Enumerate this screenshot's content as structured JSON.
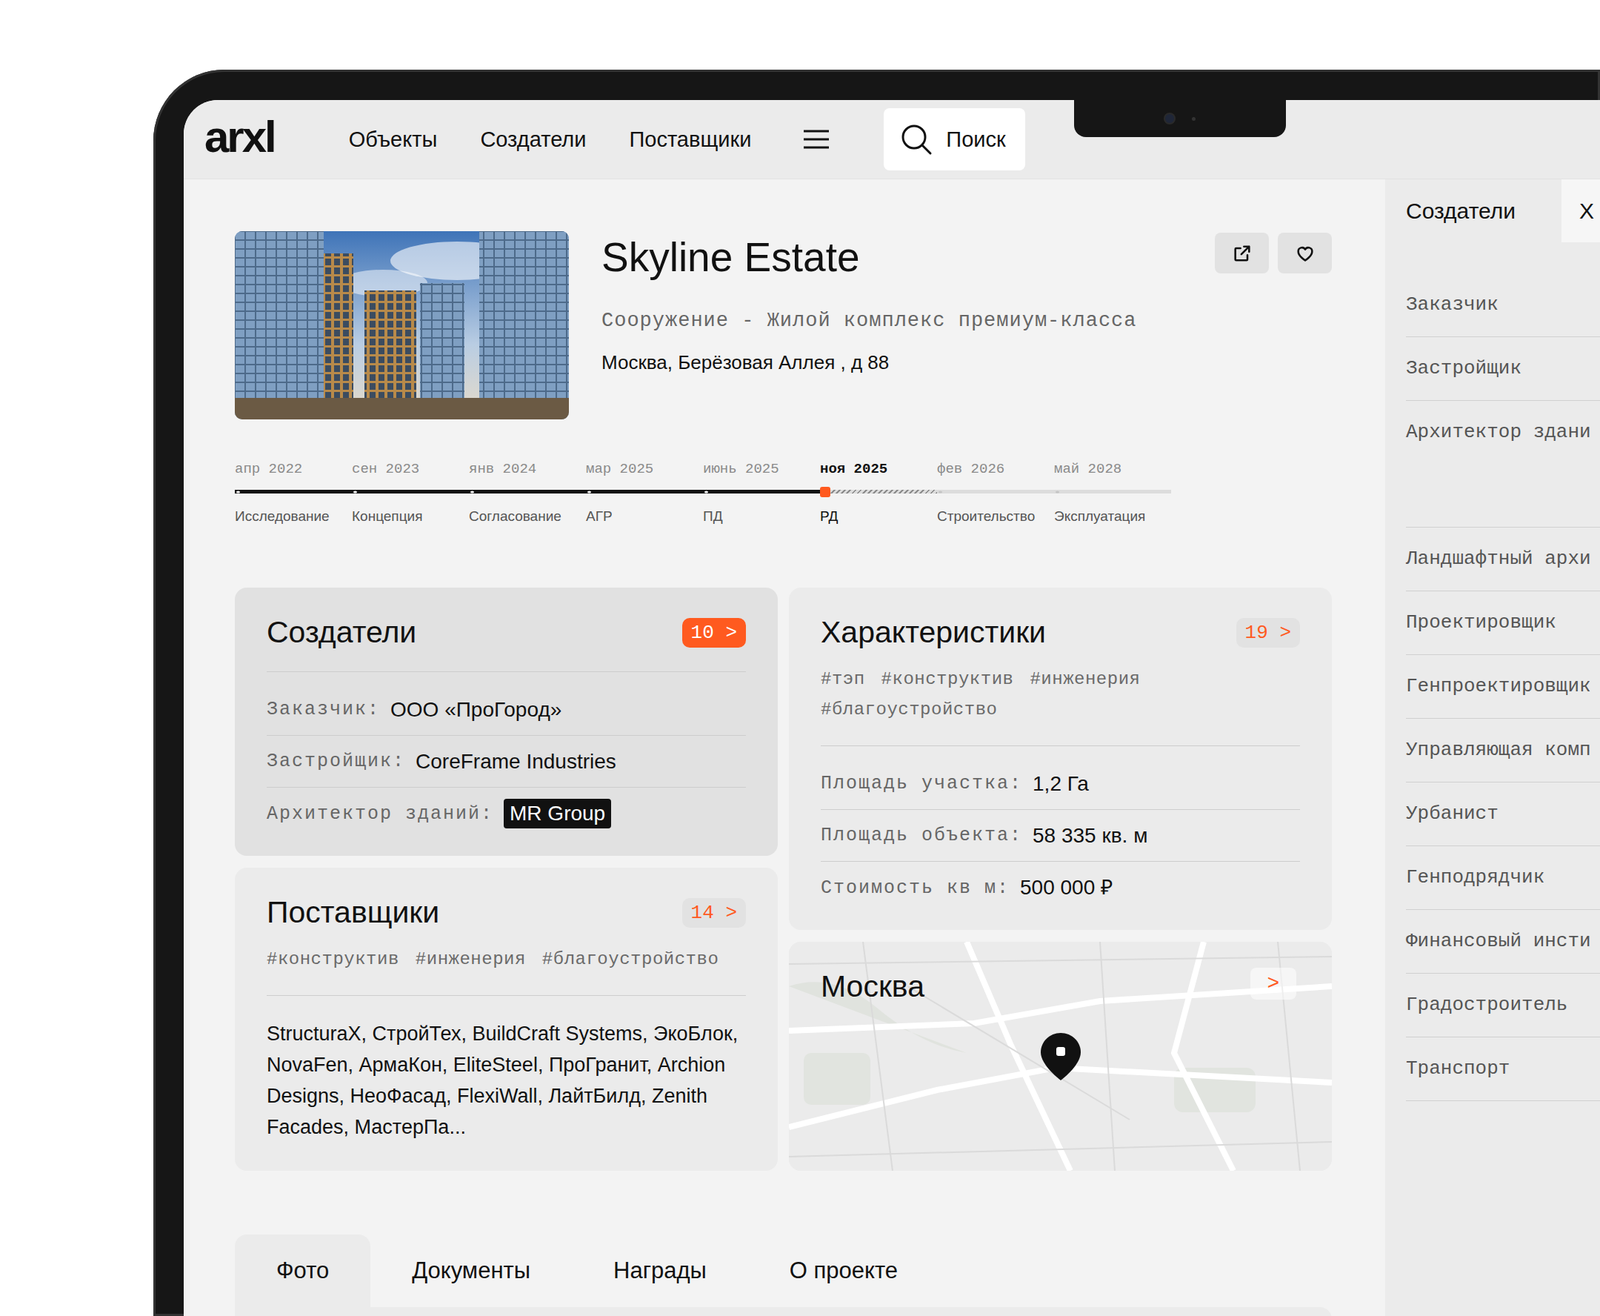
{
  "nav": {
    "logo": "arxl",
    "items": [
      {
        "label": "Объекты",
        "selected": false
      },
      {
        "label": "Создатели",
        "selected": false
      },
      {
        "label": "Поставщики",
        "selected": false
      }
    ],
    "search": {
      "placeholder": "Поиск"
    }
  },
  "project": {
    "title": "Skyline Estate",
    "type": "Сооружение - Жилой комплекс премиум-класса",
    "address": "Москва, Берёзовая Аллея , д 88",
    "favorite": false
  },
  "timeline": {
    "stages": [
      {
        "date": "апр 2022",
        "label": "Исследование",
        "status": "done"
      },
      {
        "date": "сен 2023",
        "label": "Концепция",
        "status": "done"
      },
      {
        "date": "янв 2024",
        "label": "Согласование",
        "status": "done"
      },
      {
        "date": "мар 2025",
        "label": "АГР",
        "status": "done"
      },
      {
        "date": "июнь 2025",
        "label": "ПД",
        "status": "done"
      },
      {
        "date": "ноя 2025",
        "label": "РД",
        "status": "current"
      },
      {
        "date": "фев 2026",
        "label": "Строительство",
        "status": "planned"
      },
      {
        "date": "май 2028",
        "label": "Эксплуатация",
        "status": "planned"
      }
    ]
  },
  "creators": {
    "title": "Создатели",
    "badge": "10 >",
    "highlighted": true,
    "rows": [
      {
        "label": "Заказчик:",
        "value": "ООО «ПроГород»",
        "highlighted": false
      },
      {
        "label": "Застройщик:",
        "value": "CoreFrame Industries",
        "highlighted": false
      },
      {
        "label": "Архитектор зданий:",
        "value": "MR Group",
        "highlighted": true
      }
    ]
  },
  "characteristics": {
    "title": "Характеристики",
    "badge": "19 >",
    "highlighted": false,
    "tags": [
      "#тэп",
      "#конструктив",
      "#инженерия",
      "#благоустройство"
    ],
    "rows": [
      {
        "label": "Площадь участка:",
        "value": "1,2 Га",
        "highlighted": false
      },
      {
        "label": "Площадь объекта:",
        "value": "58 335 кв. м",
        "highlighted": false
      },
      {
        "label": "Стоимость кв м:",
        "value": "500 000 ₽",
        "highlighted": false
      }
    ]
  },
  "suppliers": {
    "title": "Поставщики",
    "badge": "14 >",
    "highlighted": false,
    "tags": [
      "#конструктив",
      "#инженерия",
      "#благоустройство"
    ],
    "list": "StructuraX, СтройТех, BuildCraft Systems, ЭкоБлок, NovaFen, АрмаКон, EliteSteel, ПроГранит, Archion Designs, НеоФасад, FlexiWall, ЛайтБилд, Zenith Facades, МастерПа..."
  },
  "map": {
    "title": "Москва",
    "arrow": ">"
  },
  "bottom_tabs": [
    {
      "label": "Фото",
      "selected": true
    },
    {
      "label": "Документы",
      "selected": false
    },
    {
      "label": "Награды",
      "selected": false
    },
    {
      "label": "О проекте",
      "selected": false
    }
  ],
  "sidebar": {
    "tabs": [
      {
        "label": "Создатели",
        "selected": true
      },
      {
        "label": "Х",
        "selected": false
      }
    ],
    "items": [
      "Заказчик",
      "Застройщик",
      "Архитектор здани",
      "Ландшафтный архи",
      "Проектировщик",
      "Генпроектировщик",
      "Управляющая комп",
      "Урбанист",
      "Генподрядчик",
      "Финансовый инсти",
      "Градостроитель",
      "Транспорт"
    ]
  }
}
